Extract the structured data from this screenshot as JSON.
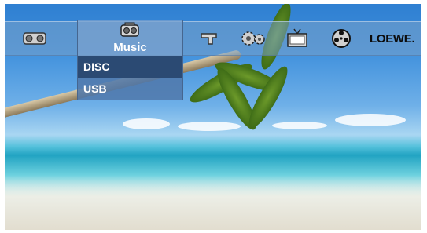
{
  "menu": {
    "active_label": "Music",
    "icons": [
      "film-reel-icon",
      "music-icon",
      "flag-icon",
      "settings-gears-icon",
      "tv-icon",
      "disc-reel-icon"
    ],
    "brand": "LOEWE."
  },
  "dropdown": {
    "items": [
      {
        "label": "DISC",
        "selected": true
      },
      {
        "label": "USB",
        "selected": false
      }
    ]
  },
  "colors": {
    "selected_bg": "#2b4a73",
    "menu_border": "#46668f",
    "text": "#ffffff"
  }
}
